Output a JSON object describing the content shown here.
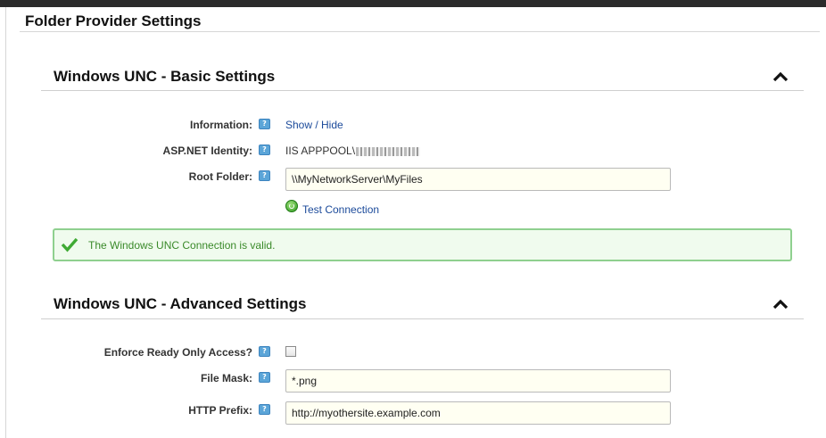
{
  "page": {
    "title": "Folder Provider Settings"
  },
  "basic": {
    "title": "Windows UNC - Basic Settings",
    "information_label": "Information:",
    "show_hide_link": "Show / Hide",
    "identity_label": "ASP.NET Identity:",
    "identity_value": "IIS APPPOOL\\",
    "root_folder_label": "Root Folder:",
    "root_folder_value": "\\\\MyNetworkServer\\MyFiles",
    "test_connection_link": "Test Connection"
  },
  "status": {
    "message": "The Windows UNC Connection is valid."
  },
  "advanced": {
    "title": "Windows UNC - Advanced Settings",
    "enforce_label": "Enforce Ready Only Access?",
    "enforce_checked": false,
    "file_mask_label": "File Mask:",
    "file_mask_value": "*.png",
    "http_prefix_label": "HTTP Prefix:",
    "http_prefix_value": "http://myothersite.example.com"
  },
  "icons": {
    "help": "help-icon",
    "collapse": "chevron-up-icon",
    "success": "checkmark-icon",
    "test": "refresh-icon"
  },
  "colors": {
    "link": "#1b4a9a",
    "success_border": "#8fd08f",
    "success_bg": "#f0fbee",
    "success_text": "#3a8a2a",
    "input_bg": "#fffff2",
    "help_icon": "#5ba5d8"
  }
}
